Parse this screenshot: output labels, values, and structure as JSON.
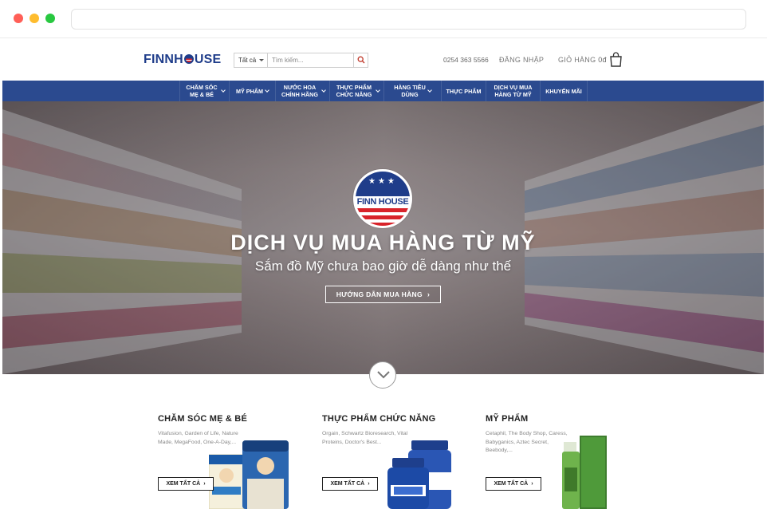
{
  "header": {
    "logo": "FINNHOUSE",
    "search": {
      "category": "Tất cả",
      "placeholder": "Tìm kiếm..."
    },
    "phone": "0254 363 5566",
    "login": "ĐĂNG NHẬP",
    "cart_label": "GIỎ HÀNG",
    "cart_amount": "0đ"
  },
  "nav": {
    "items": [
      {
        "label": "CHĂM SÓC MẸ & BÉ",
        "has_menu": true
      },
      {
        "label": "MỸ PHẨM",
        "has_menu": true
      },
      {
        "label": "NƯỚC HOA CHÍNH HÃNG",
        "has_menu": true
      },
      {
        "label": "THỰC PHẨM CHỨC NĂNG",
        "has_menu": true
      },
      {
        "label": "HÀNG TIÊU DÙNG",
        "has_menu": true
      },
      {
        "label": "THỰC PHẨM",
        "has_menu": false
      },
      {
        "label": "DỊCH VỤ MUA HÀNG TỪ MỸ",
        "has_menu": false
      },
      {
        "label": "KHUYẾN MÃI",
        "has_menu": false
      }
    ]
  },
  "hero": {
    "badge_name": "FINN HOUSE",
    "title": "DỊCH VỤ MUA HÀNG TỪ MỸ",
    "subtitle": "Sắm đồ Mỹ chưa bao giờ dễ dàng như thế",
    "button": "HƯỚNG DẪN MUA HÀNG"
  },
  "categories": [
    {
      "title": "CHĂM SÓC MẸ & BÉ",
      "desc": "Vitafusion, Garden of Life, Nature Made, MegaFood, One-A-Day,...",
      "button": "XEM TẤT CẢ"
    },
    {
      "title": "THỰC PHẨM CHỨC NĂNG",
      "desc": "Orgain, Schwartz Bioresearch, Vital Proteins, Doctor's Best...",
      "button": "XEM TẤT CẢ"
    },
    {
      "title": "MỸ PHẨM",
      "desc": "Cetaphil, The Body Shop, Caress, Babyganics, Aztec Secret, Beebody,...",
      "button": "XEM TẤT CẢ"
    }
  ],
  "colors": {
    "brand_blue": "#2b4a8f",
    "accent_red": "#d8232a"
  },
  "icons": [
    "search-icon",
    "shopping-bag-icon",
    "chevron-down-icon"
  ]
}
